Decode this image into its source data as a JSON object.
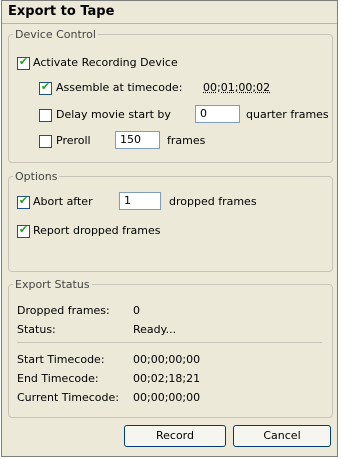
{
  "window": {
    "title": "Export to Tape"
  },
  "device_control": {
    "legend": "Device Control",
    "activate": {
      "label": "Activate Recording Device",
      "checked": true
    },
    "assemble": {
      "label": "Assemble at timecode:",
      "checked": true,
      "value": "00;01;00;02"
    },
    "delay": {
      "label": "Delay movie start by",
      "checked": false,
      "value": "0",
      "unit": "quarter frames"
    },
    "preroll": {
      "label": "Preroll",
      "checked": false,
      "value": "150",
      "unit": "frames"
    }
  },
  "options": {
    "legend": "Options",
    "abort": {
      "label": "Abort after",
      "checked": true,
      "value": "1",
      "unit": "dropped frames"
    },
    "report": {
      "label": "Report dropped frames",
      "checked": true
    }
  },
  "export_status": {
    "legend": "Export Status",
    "dropped_label": "Dropped frames:",
    "dropped_value": "0",
    "status_label": "Status:",
    "status_value": "Ready...",
    "start_label": "Start Timecode:",
    "start_value": "00;00;00;00",
    "end_label": "End Timecode:",
    "end_value": "00;02;18;21",
    "current_label": "Current Timecode:",
    "current_value": "00;00;00;00"
  },
  "buttons": {
    "record": "Record",
    "cancel": "Cancel"
  },
  "colors": {
    "dialog_bg": "#ece9d8",
    "checkmark": "#21a121",
    "button_border": "#003c74"
  }
}
